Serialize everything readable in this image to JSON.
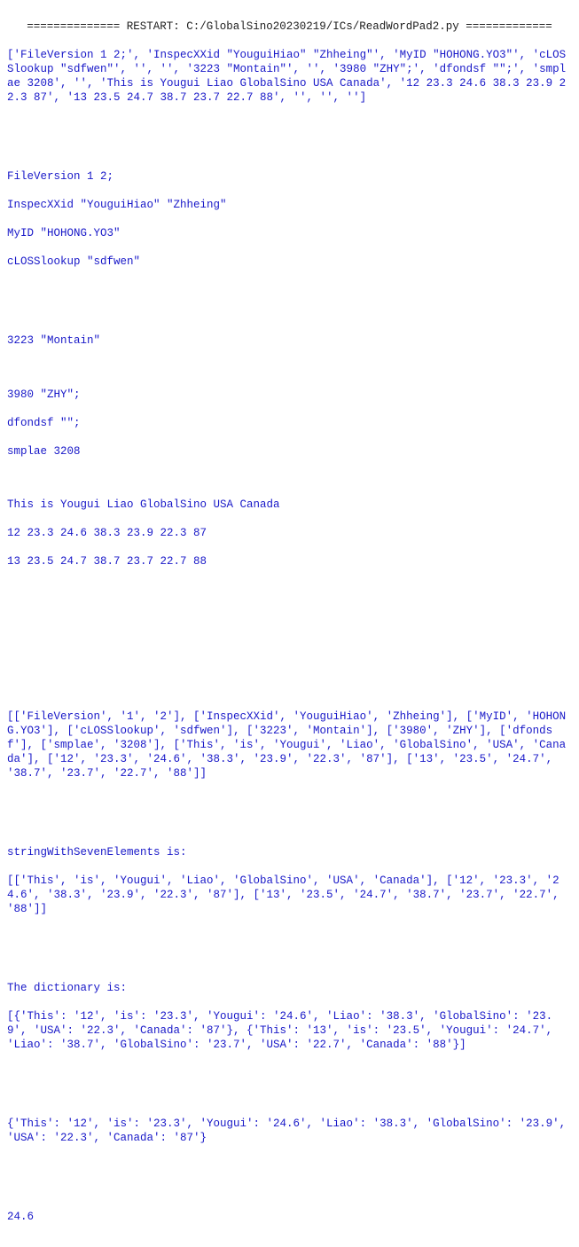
{
  "header_line": "============== RESTART: C:/GlobalSino20230219/ICs/ReadWordPad2.py =============",
  "block1": "['FileVersion 1 2;', 'InspecXXid \"YouguiHiao\" \"Zhheing\"', 'MyID \"HOHONG.YO3\"', 'cLOSSlookup \"sdfwen\"', '', '', '3223 \"Montain\"', '', '3980 \"ZHY\";', 'dfondsf \"\";', 'smplae 3208', '', 'This is Yougui Liao GlobalSino USA Canada', '12 23.3 24.6 38.3 23.9 22.3 87', '13 23.5 24.7 38.7 23.7 22.7 88', '', '', '']",
  "block2_l1": "FileVersion 1 2;",
  "block2_l2": "InspecXXid \"YouguiHiao\" \"Zhheing\"",
  "block2_l3": "MyID \"HOHONG.YO3\"",
  "block2_l4": "cLOSSlookup \"sdfwen\"",
  "block3_l1": "3223 \"Montain\"",
  "block4_l1": "3980 \"ZHY\";",
  "block4_l2": "dfondsf \"\";",
  "block4_l3": "smplae 3208",
  "block5_l1": "This is Yougui Liao GlobalSino USA Canada",
  "block5_l2": "12 23.3 24.6 38.3 23.9 22.3 87",
  "block5_l3": "13 23.5 24.7 38.7 23.7 22.7 88",
  "block6": "[['FileVersion', '1', '2'], ['InspecXXid', 'YouguiHiao', 'Zhheing'], ['MyID', 'HOHONG.YO3'], ['cLOSSlookup', 'sdfwen'], ['3223', 'Montain'], ['3980', 'ZHY'], ['dfondsf'], ['smplae', '3208'], ['This', 'is', 'Yougui', 'Liao', 'GlobalSino', 'USA', 'Canada'], ['12', '23.3', '24.6', '38.3', '23.9', '22.3', '87'], ['13', '23.5', '24.7', '38.7', '23.7', '22.7', '88']]",
  "block7_l1": "stringWithSevenElements is:",
  "block7_l2": "[['This', 'is', 'Yougui', 'Liao', 'GlobalSino', 'USA', 'Canada'], ['12', '23.3', '24.6', '38.3', '23.9', '22.3', '87'], ['13', '23.5', '24.7', '38.7', '23.7', '22.7', '88']]",
  "block8_l1": "The dictionary is:",
  "block8_l2": "[{'This': '12', 'is': '23.3', 'Yougui': '24.6', 'Liao': '38.3', 'GlobalSino': '23.9', 'USA': '22.3', 'Canada': '87'}, {'This': '13', 'is': '23.5', 'Yougui': '24.7', 'Liao': '38.7', 'GlobalSino': '23.7', 'USA': '22.7', 'Canada': '88'}]",
  "block9": "{'This': '12', 'is': '23.3', 'Yougui': '24.6', 'Liao': '38.3', 'GlobalSino': '23.9', 'USA': '22.3', 'Canada': '87'}",
  "block10": "24.6"
}
